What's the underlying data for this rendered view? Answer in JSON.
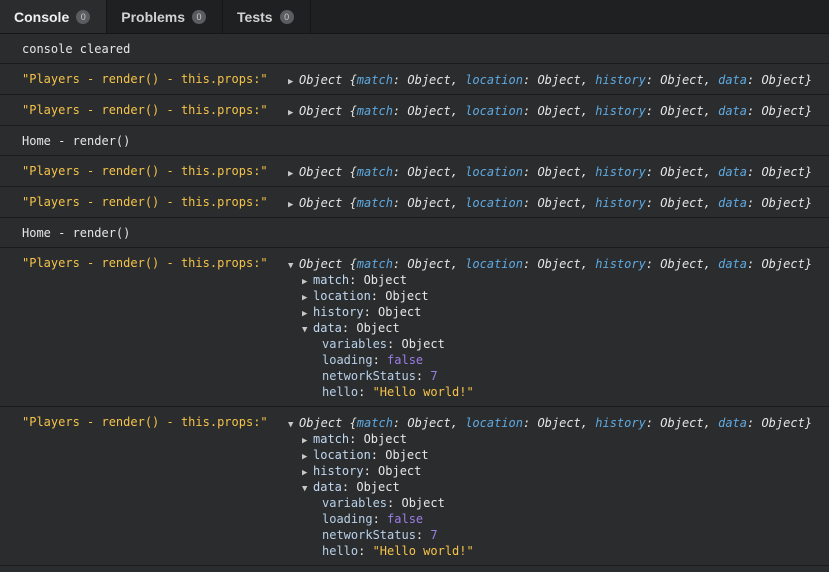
{
  "tabs": [
    {
      "label": "Console",
      "count": "0"
    },
    {
      "label": "Problems",
      "count": "0"
    },
    {
      "label": "Tests",
      "count": "0"
    }
  ],
  "console": {
    "cleared": "console cleared",
    "log_label": "\"Players - render() - this.props:\"",
    "home_label": "Home - render()",
    "obj_prefix": "Object {",
    "obj_suffix": "}",
    "keys": [
      "match",
      "location",
      "history",
      "data"
    ],
    "obj_type": "Object",
    "expanded_props": [
      "match",
      "location",
      "history"
    ],
    "data_key": "data",
    "data_children": {
      "variables_key": "variables",
      "variables_val": "Object",
      "loading_key": "loading",
      "loading_val": "false",
      "networkStatus_key": "networkStatus",
      "networkStatus_val": "7",
      "hello_key": "hello",
      "hello_val": "\"Hello world!\""
    }
  },
  "icons": {
    "collapsed": "triangle-right-icon",
    "expanded": "triangle-down-icon"
  }
}
